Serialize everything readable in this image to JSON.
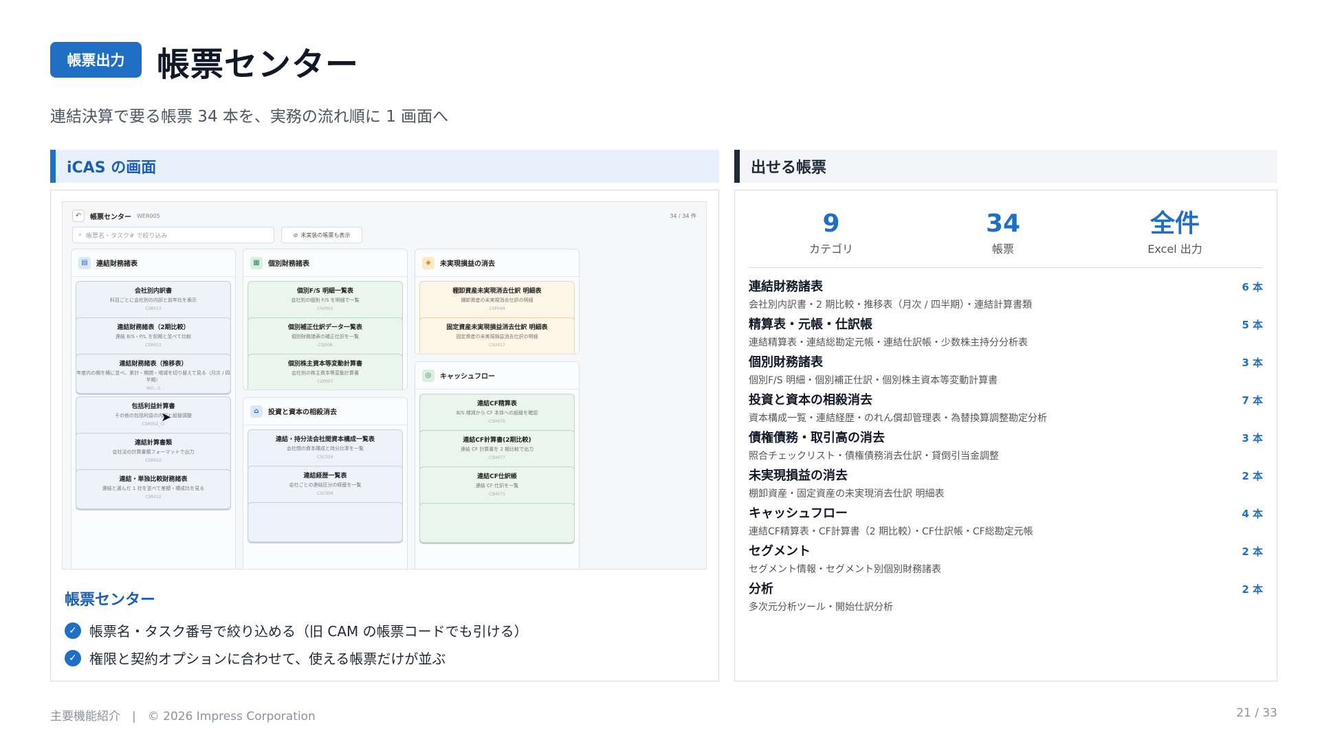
{
  "header": {
    "badge": "帳票出力",
    "title": "帳票センター",
    "subtitle": "連結決算で要る帳票 34 本を、実務の流れ順に 1 画面へ"
  },
  "left": {
    "heading": "iCAS の画面",
    "caption_title": "帳票センター",
    "features": [
      "帳票名・タスク番号で絞り込める（旧 CAM の帳票コードでも引ける）",
      "権限と契約オプションに合わせて、使える帳票だけが並ぶ"
    ]
  },
  "screenshot": {
    "title": "帳票センター",
    "code": "WER005",
    "count": "34 / 34 件",
    "search_placeholder": "帳票名・タスク# で絞り込み",
    "toggle": "未実装の帳票も表示",
    "groups": [
      {
        "name": "連結財務諸表",
        "cards": [
          {
            "title": "会社別内訳書",
            "desc": "科目ごとに会社別の内訳と前年比を表示",
            "code": "CSR013"
          },
          {
            "title": "連結財務諸表（2期比較）",
            "desc": "連結 B/S・P/L を前期と並べて比較",
            "code": "CSR011"
          },
          {
            "title": "連結財務諸表（推移表）",
            "desc": "年度内の期を横に並べ、累計・期間・増減を切り替えて見る（月次 / 四半期）",
            "code": "WO...S"
          },
          {
            "title": "包括利益計算書",
            "desc": "その他の包括利益の内訳と組替調整",
            "code": "CSR002_CI"
          },
          {
            "title": "連結計算書類",
            "desc": "会社法の計算書類フォーマットで出力",
            "code": "CSR010"
          },
          {
            "title": "連結・単独比較財務諸表",
            "desc": "連結と選んだ 1 社を並べて差額・構成比を見る",
            "code": "CSR012"
          }
        ]
      },
      {
        "name": "個別財務諸表",
        "cards": [
          {
            "title": "個別F/S 明細一覧表",
            "desc": "会社別の個別 F/S を明細で一覧",
            "code": "CSV002"
          },
          {
            "title": "個別補正仕訳データ一覧表",
            "desc": "個別財務諸表の補正仕訳を一覧",
            "code": "CSJ008"
          },
          {
            "title": "個別株主資本等変動計算書",
            "desc": "会社別の株主資本等変動計算書",
            "code": "CSP007"
          }
        ]
      },
      {
        "name": "投資と資本の相殺消去",
        "cards": [
          {
            "title": "連結・持分法会社間資本構成一覧表",
            "desc": "会社間の資本構成と持分比率を一覧",
            "code": "CSC026"
          },
          {
            "title": "連結経歴一覧表",
            "desc": "会社ごとの連結区分の経歴を一覧",
            "code": "CSC006"
          }
        ]
      },
      {
        "name": "未実現損益の消去",
        "cards": [
          {
            "title": "棚卸資産未実現消去仕訳 明細表",
            "desc": "棚卸資産の未実現消去仕訳の明細",
            "code": "CSP049"
          },
          {
            "title": "固定資産未実現損益消去仕訳 明細表",
            "desc": "固定資産の未実現損益消去仕訳の明細",
            "code": "CSU017"
          }
        ]
      },
      {
        "name": "キャッシュフロー",
        "cards": [
          {
            "title": "連結CF精算表",
            "desc": "B/S 増減から CF 本体への組替を確認",
            "code": "CSH075"
          },
          {
            "title": "連結CF計算書(2期比較)",
            "desc": "連結 CF 計算書を 2 期比較で出力",
            "code": "CSH077"
          },
          {
            "title": "連結CF仕訳帳",
            "desc": "連結 CF 仕訳を一覧",
            "code": "CSH071"
          }
        ]
      }
    ]
  },
  "right": {
    "heading": "出せる帳票",
    "stats": [
      {
        "value": "9",
        "label": "カテゴリ"
      },
      {
        "value": "34",
        "label": "帳票"
      },
      {
        "value": "全件",
        "label": "Excel 出力"
      }
    ],
    "categories": [
      {
        "name": "連結財務諸表",
        "count": "6 本",
        "desc": "会社別内訳書・2 期比較・推移表（月次 / 四半期）・連結計算書類"
      },
      {
        "name": "精算表・元帳・仕訳帳",
        "count": "5 本",
        "desc": "連結精算表・連結総勘定元帳・連結仕訳帳・少数株主持分分析表"
      },
      {
        "name": "個別財務諸表",
        "count": "3 本",
        "desc": "個別F/S 明細・個別補正仕訳・個別株主資本等変動計算書"
      },
      {
        "name": "投資と資本の相殺消去",
        "count": "7 本",
        "desc": "資本構成一覧・連結経歴・のれん償却管理表・為替換算調整勘定分析"
      },
      {
        "name": "債権債務・取引高の消去",
        "count": "3 本",
        "desc": "照合チェックリスト・債権債務消去仕訳・貸倒引当金調整"
      },
      {
        "name": "未実現損益の消去",
        "count": "2 本",
        "desc": "棚卸資産・固定資産の未実現消去仕訳 明細表"
      },
      {
        "name": "キャッシュフロー",
        "count": "4 本",
        "desc": "連結CF精算表・CF計算書（2 期比較）・CF仕訳帳・CF総勘定元帳"
      },
      {
        "name": "セグメント",
        "count": "2 本",
        "desc": "セグメント情報・セグメント別個別財務諸表"
      },
      {
        "name": "分析",
        "count": "2 本",
        "desc": "多次元分析ツール・開始仕訳分析"
      }
    ]
  },
  "footer": {
    "left": "主要機能紹介　|　© 2026 Impress Corporation",
    "page": "21 / 33"
  }
}
